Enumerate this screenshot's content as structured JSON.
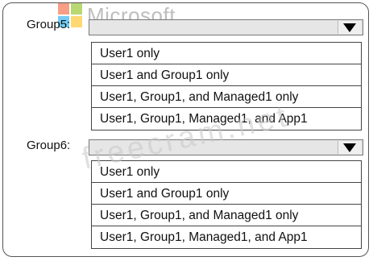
{
  "brand": {
    "name": "Microsoft"
  },
  "watermark": "freecram.net",
  "colors": {
    "logo_red": "#f25022",
    "logo_green": "#7fba00",
    "logo_blue": "#00a4ef",
    "logo_yellow": "#ffb900"
  },
  "groups": [
    {
      "label": "Group5:",
      "options": [
        "User1 only",
        "User1 and Group1 only",
        "User1, Group1, and Managed1 only",
        "User1, Group1, Managed1, and App1"
      ]
    },
    {
      "label": "Group6:",
      "options": [
        "User1 only",
        "User1 and Group1 only",
        "User1, Group1, and Managed1 only",
        "User1, Group1, Managed1, and App1"
      ]
    }
  ]
}
